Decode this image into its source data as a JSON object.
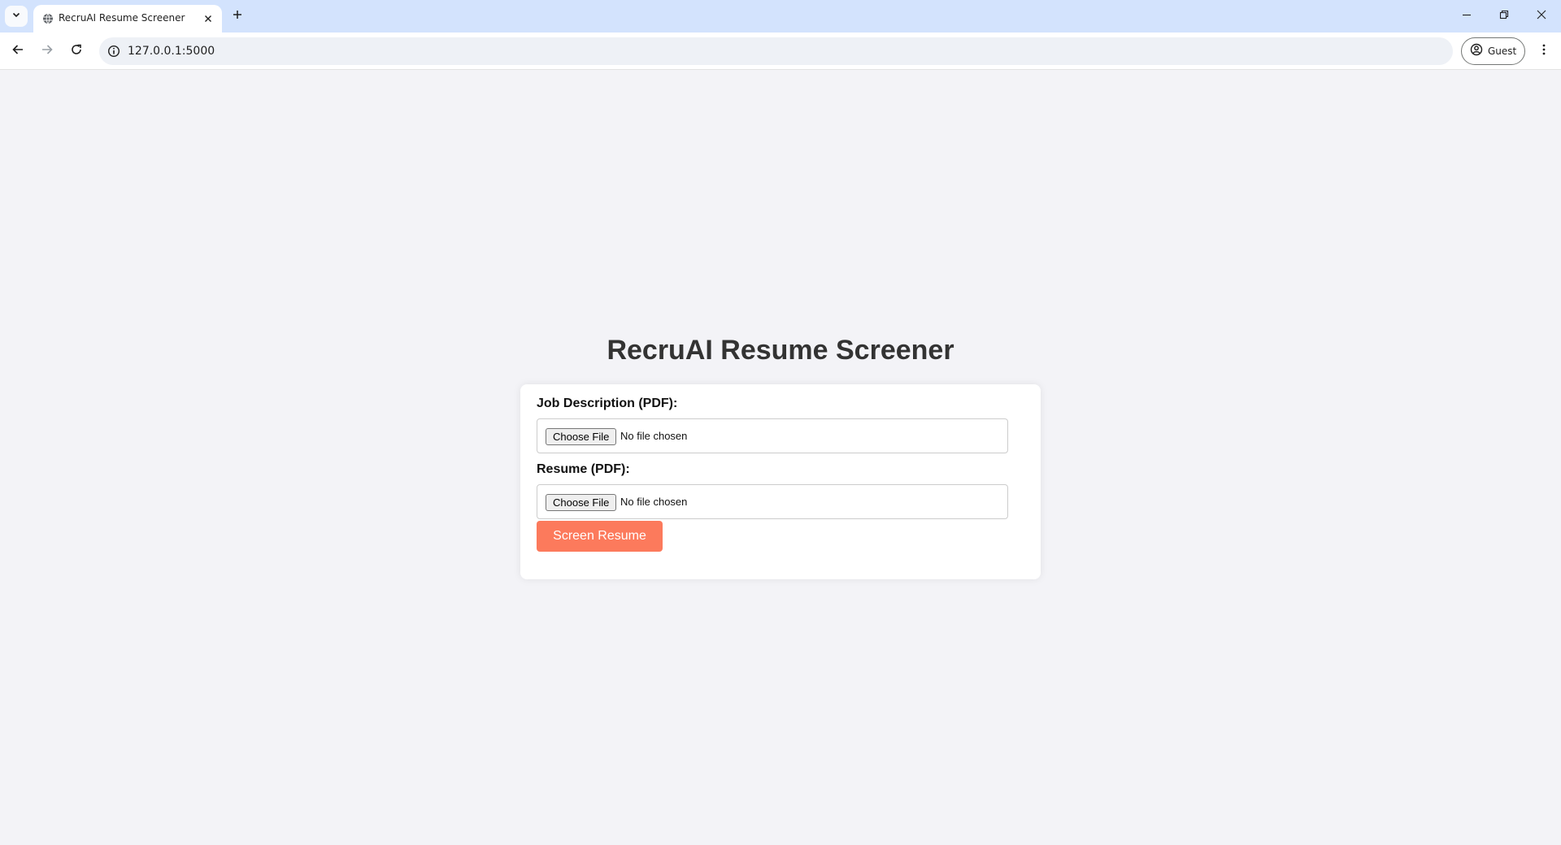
{
  "browser": {
    "tab": {
      "title": "RecruAI Resume Screener"
    },
    "address_bar": {
      "url": "127.0.0.1:5000"
    },
    "profile": {
      "label": "Guest"
    }
  },
  "page": {
    "title": "RecruAI Resume Screener",
    "form": {
      "job_description": {
        "label": "Job Description (PDF):",
        "button_label": "Choose File",
        "status": "No file chosen"
      },
      "resume": {
        "label": "Resume (PDF):",
        "button_label": "Choose File",
        "status": "No file chosen"
      },
      "submit_label": "Screen Resume"
    }
  },
  "colors": {
    "tabbar_bg": "#d3e3fd",
    "page_bg": "#f3f3f7",
    "submit_button": "#fc7a5c",
    "title_text": "#333333"
  }
}
